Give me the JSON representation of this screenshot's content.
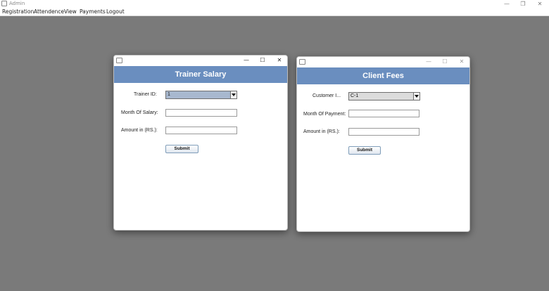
{
  "window": {
    "title": "Admin",
    "icon": "app-icon",
    "controls": {
      "minimize": "—",
      "restore": "❐",
      "close": "✕"
    }
  },
  "menubar": {
    "items": [
      "Registration",
      "Attendence",
      "View",
      "Payments",
      "Logout"
    ]
  },
  "trainer_salary": {
    "title": "Trainer Salary",
    "controls": {
      "minimize": "—",
      "maximize": "☐",
      "close": "✕"
    },
    "trainer_id_label": "Trainer ID:",
    "trainer_id_value": "1",
    "month_label": "Month Of Salary:",
    "month_value": "",
    "amount_label": "Amount in (RS.):",
    "amount_value": "",
    "submit_label": "Submit",
    "colors": {
      "banner": "#6a8ebf",
      "combo_selected": "#a8b8cf"
    }
  },
  "client_fees": {
    "title": "Client Fees",
    "controls": {
      "minimize": "—",
      "maximize": "☐",
      "close": "✕"
    },
    "customer_id_label": "Customer I...",
    "customer_id_value": "C-1",
    "month_label": "Month Of Payment:",
    "month_value": "",
    "amount_label": "Amount in (RS.):",
    "amount_value": "",
    "submit_label": "Submit",
    "colors": {
      "banner": "#6a8ebf",
      "combo_selected": "#dcdcdc"
    }
  }
}
